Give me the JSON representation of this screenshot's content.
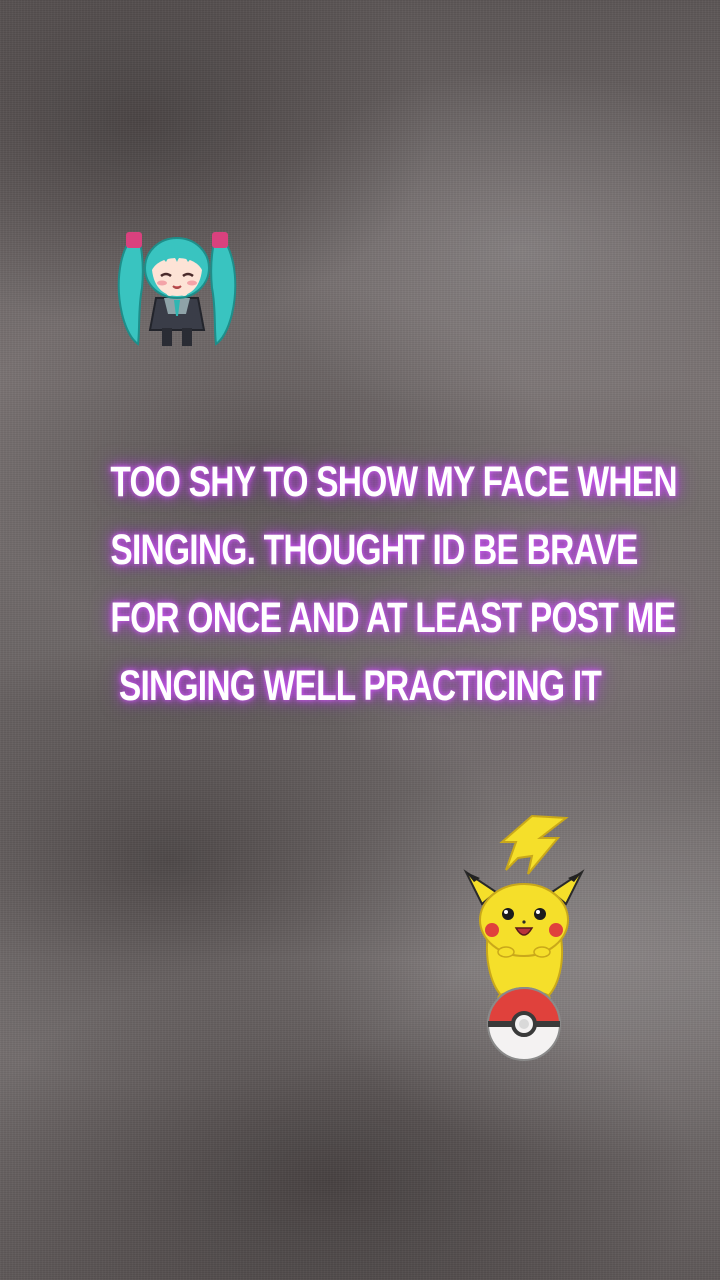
{
  "story": {
    "caption_lines": [
      "TOO SHY TO SHOW MY FACE WHEN",
      "SINGING. THOUGHT ID BE BRAVE",
      "FOR ONCE AND AT LEAST POST ME",
      "SINGING WELL PRACTICING IT"
    ],
    "caption_glow_color": "#c04af0",
    "stickers": [
      {
        "icon": "chibi-twintail-girl-icon"
      },
      {
        "icon": "pikachu-on-pokeball-icon"
      }
    ]
  }
}
